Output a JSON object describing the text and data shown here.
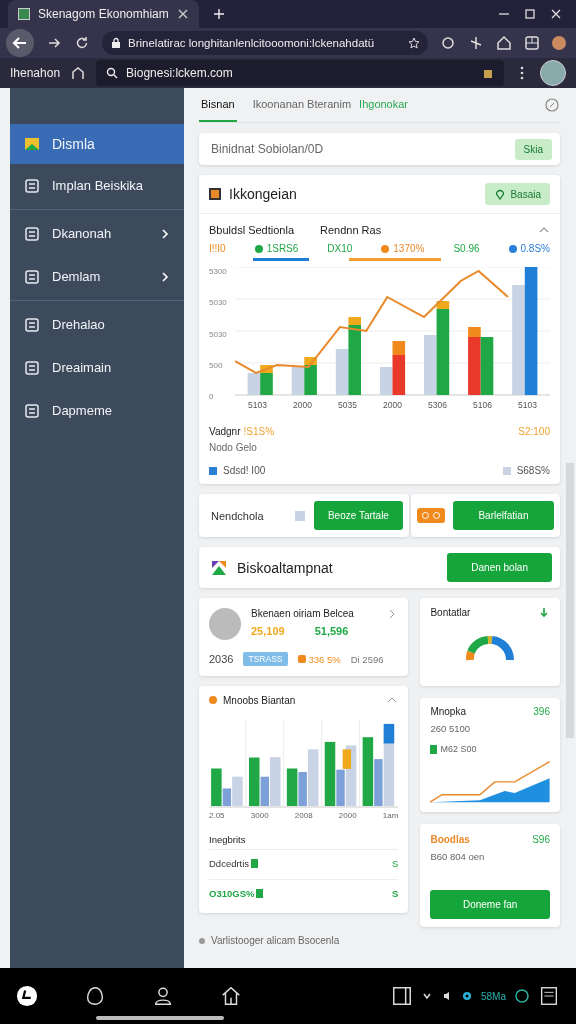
{
  "browser": {
    "tab_title": "Skenagom Ekonomhiam",
    "url": "Brinelatirac longhitanlenlcitooomoni:lckenahdatü",
    "bookmark_label": "Ihenahon",
    "search_value": "Biognesi:lckem.com"
  },
  "sidebar": {
    "items": [
      {
        "label": "Dismla",
        "selected": true,
        "expandable": false
      },
      {
        "label": "Implan Beiskika",
        "selected": false,
        "expandable": false
      },
      {
        "label": "Dkanonah",
        "selected": false,
        "expandable": true
      },
      {
        "label": "Demlam",
        "selected": false,
        "expandable": true
      },
      {
        "label": "Drehalao",
        "selected": false,
        "expandable": false
      },
      {
        "label": "Dreaimain",
        "selected": false,
        "expandable": false
      },
      {
        "label": "Dapmeme",
        "selected": false,
        "expandable": false
      }
    ]
  },
  "tabs": [
    {
      "label": "Bisnan",
      "selected": true,
      "kind": "tab"
    },
    {
      "label": "Ikoonanan Bteranim",
      "selected": false,
      "kind": "tab"
    },
    {
      "label": "Ihgonokar",
      "selected": false,
      "kind": "link"
    }
  ],
  "search_card": {
    "placeholder": "Binidnat Sobiolan/0D",
    "button": "Skia"
  },
  "chart_card": {
    "title": "Ikkongeian",
    "button": "Basaia",
    "subtitle_1": "Bbuldsl Sedtionla",
    "subtitle_2": "Rendnn Ras",
    "stats": [
      {
        "text": "I!!I0",
        "kind": "warning",
        "dot": false
      },
      {
        "text": "1SRS6",
        "kind": "positive",
        "dot": true,
        "color": "#1fa845"
      },
      {
        "text": "DX10",
        "kind": "positive",
        "dot": false
      },
      {
        "text": "1370%",
        "kind": "warning",
        "dot": true,
        "color": "#f08a1c"
      },
      {
        "text": "S0.96",
        "kind": "positive",
        "dot": false
      },
      {
        "text": "0.8S%",
        "kind": "info",
        "dot": true,
        "color": "#2b7fd6"
      }
    ],
    "y_labels": [
      "5300",
      "5030",
      "5030",
      "500",
      "0"
    ],
    "x_labels": [
      "5103",
      "2000",
      "5035",
      "2000",
      "5306",
      "5106",
      "5103"
    ],
    "footer_title": "Vadgnr",
    "footer_value": "!S1S%",
    "footer_sub": "Nodo Gelo",
    "footer_right": "S2:100",
    "legend": [
      {
        "label": "Sdsd! I00",
        "color": "#2b7fd6"
      },
      {
        "label": "S68S%",
        "color": "#c9d3e6"
      }
    ]
  },
  "action_row": {
    "label": "Nendchola",
    "button_1": "Beoze Tartale",
    "button_2": "Barlelfatian"
  },
  "section": {
    "title": "Biskoaltampnat",
    "button": "Danen bolan"
  },
  "profile_card": {
    "name": "Bkenaen oiriam Belcea",
    "value_1": "25,109",
    "value_2": "51,596",
    "year": "2036",
    "tag": "TSRASS",
    "change": "336 5%",
    "other": "Di 2596"
  },
  "donut_card": {
    "title": "Bontatlar"
  },
  "bar_card": {
    "title": "Mnoobs Biantan",
    "x_labels": [
      "2.05",
      "3000",
      "2008",
      "2000",
      "1am"
    ],
    "subtitle": "Inegbrits",
    "rows": [
      {
        "label": "Ddcedrtis",
        "value": "S",
        "highlighted": false
      },
      {
        "label": "O310GS%",
        "value": "S",
        "highlighted": true
      }
    ]
  },
  "line_card": {
    "title": "Mnopka",
    "value": "396",
    "sub": "260 5100",
    "legend": "M62 S00"
  },
  "cta_card": {
    "title": "Boodlas",
    "value": "S96",
    "sub": "B60 804 oen",
    "button": "Doneme fan"
  },
  "footer": "Varlistooger alicam Bsocenla",
  "taskbar": {
    "status": "58Ma"
  }
}
